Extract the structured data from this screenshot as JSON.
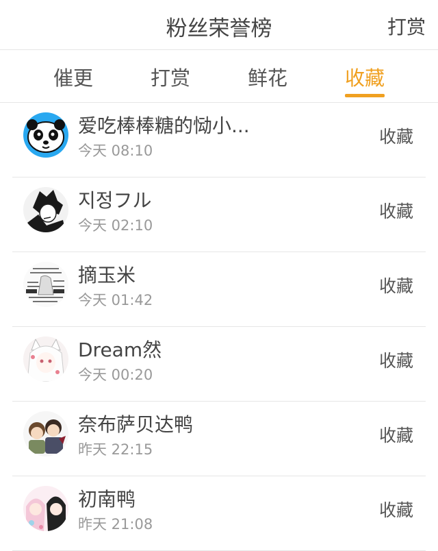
{
  "header": {
    "title": "粉丝荣誉榜",
    "action": "打赏"
  },
  "tabs": [
    {
      "label": "催更",
      "active": false
    },
    {
      "label": "打赏",
      "active": false
    },
    {
      "label": "鲜花",
      "active": false
    },
    {
      "label": "收藏",
      "active": true
    }
  ],
  "colors": {
    "accent": "#f0a020",
    "panda_bg": "#29a8f0"
  },
  "items": [
    {
      "name": "爱吃棒棒糖的恸小...",
      "time": "今天 08:10",
      "action": "收藏",
      "avatar": "panda-avatar"
    },
    {
      "name": "지정フル",
      "time": "今天 02:10",
      "action": "收藏",
      "avatar": "anime-boy-avatar"
    },
    {
      "name": "摘玉米",
      "time": "今天 01:42",
      "action": "收藏",
      "avatar": "text-collage-avatar"
    },
    {
      "name": "Dream然",
      "time": "今天 00:20",
      "action": "收藏",
      "avatar": "anime-girl-avatar"
    },
    {
      "name": "奈布萨贝达鸭",
      "time": "昨天 22:15",
      "action": "收藏",
      "avatar": "chibi-duo-avatar"
    },
    {
      "name": "初南鸭",
      "time": "昨天 21:08",
      "action": "收藏",
      "avatar": "pink-girls-avatar"
    }
  ]
}
